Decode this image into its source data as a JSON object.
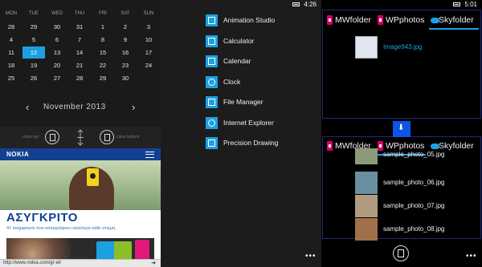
{
  "calendar": {
    "weekdays": [
      "MON",
      "TUE",
      "WED",
      "THU",
      "FRI",
      "SAT",
      "SUN"
    ],
    "rows": [
      [
        "28",
        "29",
        "30",
        "31",
        "1",
        "2",
        "3"
      ],
      [
        "4",
        "5",
        "6",
        "7",
        "8",
        "9",
        "10"
      ],
      [
        "11",
        "12",
        "13",
        "14",
        "15",
        "16",
        "17"
      ],
      [
        "18",
        "19",
        "20",
        "21",
        "22",
        "23",
        "24"
      ],
      [
        "25",
        "26",
        "27",
        "28",
        "29",
        "30",
        ""
      ]
    ],
    "selected_day": "12",
    "prev_arrow": "‹",
    "next_arrow": "›",
    "month_label": "November 2013"
  },
  "split_controls": {
    "close_top_label": "close top",
    "close_bottom_label": "close bottom"
  },
  "browser": {
    "brand": "NOKIA",
    "headline": "ΑΣΥΓΚΡΙΤΟ",
    "subheadline": "41 megapixels που καταγράφουν καλύτερα κάθε στιγμή.",
    "url": "http://www.nokia.com/gr-el/",
    "go_symbol": "➜"
  },
  "status_bar": {
    "left_time": "4:26",
    "right_time": "5:01"
  },
  "apps": [
    {
      "name": "Animation Studio",
      "icon": "film-icon"
    },
    {
      "name": "Calculator",
      "icon": "calculator-icon"
    },
    {
      "name": "Calendar",
      "icon": "calendar-icon"
    },
    {
      "name": "Clock",
      "icon": "clock-icon"
    },
    {
      "name": "File Manager",
      "icon": "folder-icon"
    },
    {
      "name": "Internet Explorer",
      "icon": "ie-icon"
    },
    {
      "name": "Precision Drawing",
      "icon": "drawing-icon"
    }
  ],
  "more_dots": "•••",
  "file_manager": {
    "top_tabs": [
      {
        "label": "MWfolder",
        "icon": "phone-icon"
      },
      {
        "label": "WPphotos",
        "icon": "phone-icon"
      },
      {
        "label": "Skyfolder",
        "icon": "cloud-icon"
      }
    ],
    "top_active_tab": "Skyfolder",
    "top_files": [
      "Image943.jpg"
    ],
    "bottom_tabs": [
      {
        "label": "MWfolder",
        "icon": "phone-icon"
      },
      {
        "label": "WPphotos",
        "icon": "phone-icon"
      },
      {
        "label": "Skyfolder",
        "icon": "cloud-icon"
      }
    ],
    "bottom_active_tab": "WPphotos",
    "bottom_files": [
      "sample_photo_05.jpg",
      "sample_photo_06.jpg",
      "sample_photo_07.jpg",
      "sample_photo_08.jpg"
    ],
    "move_arrow": "⬇"
  },
  "colors": {
    "accent": "#1ba1e2",
    "nokia_blue": "#124191",
    "move_button": "#0b55e8",
    "pane_border": "#1f2a7a"
  }
}
